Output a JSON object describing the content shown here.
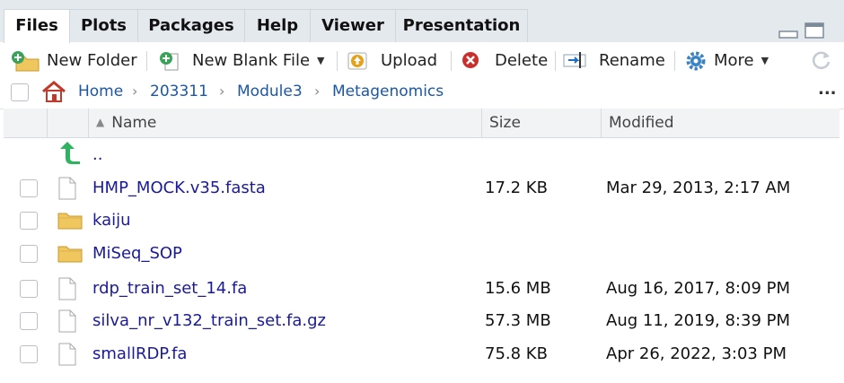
{
  "tabs": [
    {
      "label": "Files"
    },
    {
      "label": "Plots"
    },
    {
      "label": "Packages"
    },
    {
      "label": "Help"
    },
    {
      "label": "Viewer"
    },
    {
      "label": "Presentation"
    }
  ],
  "toolbar": {
    "new_folder": "New Folder",
    "new_blank_file": "New Blank File",
    "upload": "Upload",
    "delete": "Delete",
    "rename": "Rename",
    "more": "More"
  },
  "breadcrumb": [
    "Home",
    "203311",
    "Module3",
    "Metagenomics"
  ],
  "more_dots": "...",
  "columns": {
    "name": "Name",
    "size": "Size",
    "modified": "Modified"
  },
  "parent_dir": "..",
  "files": [
    {
      "name": "HMP_MOCK.v35.fasta",
      "type": "file",
      "size": "17.2 KB",
      "modified": "Mar 29, 2013, 2:17 AM"
    },
    {
      "name": "kaiju",
      "type": "folder",
      "size": "",
      "modified": ""
    },
    {
      "name": "MiSeq_SOP",
      "type": "folder",
      "size": "",
      "modified": ""
    },
    {
      "name": "rdp_train_set_14.fa",
      "type": "file",
      "size": "15.6 MB",
      "modified": "Aug 16, 2017, 8:09 PM"
    },
    {
      "name": "silva_nr_v132_train_set.fa.gz",
      "type": "file",
      "size": "57.3 MB",
      "modified": "Aug 11, 2019, 8:39 PM"
    },
    {
      "name": "smallRDP.fa",
      "type": "file",
      "size": "75.8 KB",
      "modified": "Apr 26, 2022, 3:03 PM"
    }
  ],
  "colors": {
    "accent": "#1b57a8",
    "link": "#1a1a9a",
    "folder": "#e9c46a",
    "green": "#3aa35a"
  }
}
